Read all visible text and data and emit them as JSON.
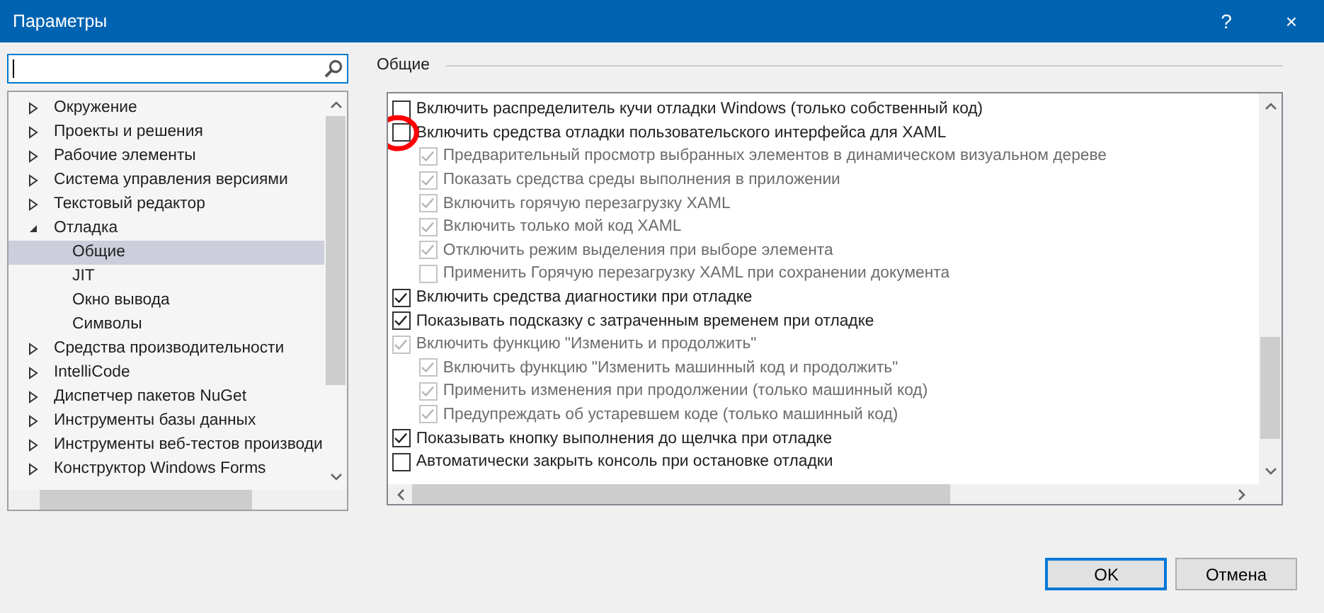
{
  "window": {
    "title": "Параметры",
    "title_buttons": [
      "?",
      "×"
    ]
  },
  "tree": [
    {
      "label": "Окружение",
      "expanded": false,
      "selected": false
    },
    {
      "label": "Проекты и решения",
      "expanded": false,
      "selected": false
    },
    {
      "label": "Рабочие элементы",
      "expanded": false,
      "selected": false
    },
    {
      "label": "Система управления версиями",
      "expanded": false,
      "selected": false
    },
    {
      "label": "Текстовый редактор",
      "expanded": false,
      "selected": false
    },
    {
      "label": "Отладка",
      "expanded": true,
      "selected": false,
      "children": [
        {
          "label": "Общие",
          "selected": true
        },
        {
          "label": "JIT",
          "selected": false
        },
        {
          "label": "Окно вывода",
          "selected": false
        },
        {
          "label": "Символы",
          "selected": false
        }
      ]
    },
    {
      "label": "Средства производительности",
      "expanded": false,
      "selected": false
    },
    {
      "label": "IntelliCode",
      "expanded": false,
      "selected": false
    },
    {
      "label": "Диспетчер пакетов NuGet",
      "expanded": false,
      "selected": false
    },
    {
      "label": "Инструменты базы данных",
      "expanded": false,
      "selected": false
    },
    {
      "label": "Инструменты веб-тестов производи",
      "expanded": false,
      "selected": false
    },
    {
      "label": "Конструктор Windows Forms",
      "expanded": false,
      "selected": false
    }
  ],
  "group_label": "Общие",
  "options": [
    {
      "label": "Включить распределитель кучи отладки Windows (только собственный код)",
      "checked": false,
      "disabled": false
    },
    {
      "label": "Включить средства отладки пользовательского интерфейса для XAML",
      "checked": false,
      "disabled": false,
      "annotated": true,
      "children": [
        {
          "label": "Предварительный просмотр выбранных элементов в динамическом визуальном дереве",
          "checked": true,
          "disabled": true
        },
        {
          "label": "Показать средства среды выполнения в приложении",
          "checked": true,
          "disabled": true
        },
        {
          "label": "Включить горячую перезагрузку XAML",
          "checked": true,
          "disabled": true
        },
        {
          "label": "Включить только мой код XAML",
          "checked": true,
          "disabled": true
        },
        {
          "label": "Отключить режим выделения при выборе элемента",
          "checked": true,
          "disabled": true
        },
        {
          "label": "Применить Горячую перезагрузку XAML при сохранении документа",
          "checked": false,
          "disabled": true
        }
      ]
    },
    {
      "label": "Включить средства диагностики при отладке",
      "checked": true,
      "disabled": false
    },
    {
      "label": "Показывать подсказку с затраченным временем при отладке",
      "checked": true,
      "disabled": false
    },
    {
      "label": "Включить функцию \"Изменить и продолжить\"",
      "checked": true,
      "disabled": true,
      "children": [
        {
          "label": "Включить функцию \"Изменить машинный код и продолжить\"",
          "checked": true,
          "disabled": true
        },
        {
          "label": "Применить изменения при продолжении (только машинный код)",
          "checked": true,
          "disabled": true
        },
        {
          "label": "Предупреждать об устаревшем коде (только машинный код)",
          "checked": true,
          "disabled": true
        }
      ]
    },
    {
      "label": "Показывать кнопку выполнения до щелчка при отладке",
      "checked": true,
      "disabled": false
    },
    {
      "label": "Автоматически закрыть консоль при остановке отладки",
      "checked": false,
      "disabled": false
    }
  ],
  "buttons": [
    {
      "label": "OK",
      "default": true
    },
    {
      "label": "Отмена",
      "default": false
    }
  ]
}
